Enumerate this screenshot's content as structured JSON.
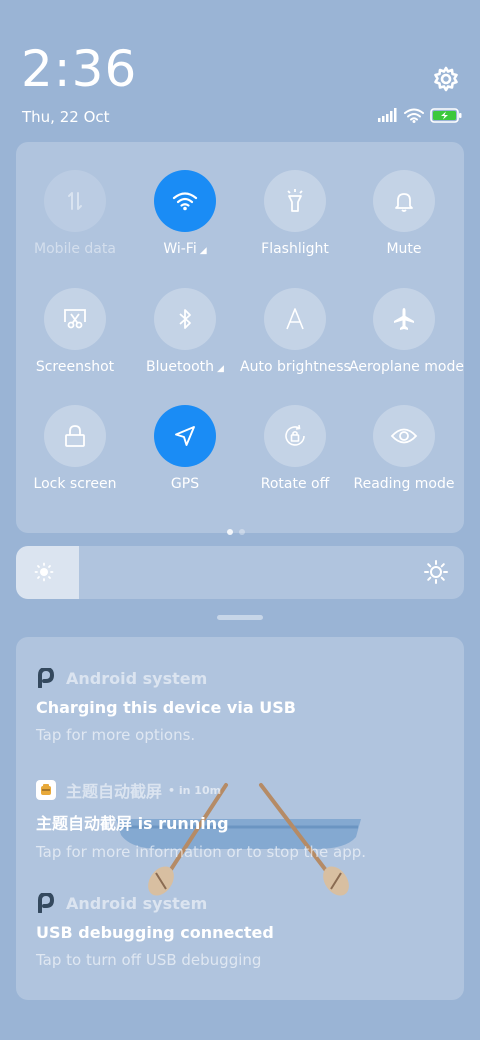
{
  "header": {
    "time": "2:36",
    "date": "Thu, 22 Oct",
    "settings_icon": "gear-icon",
    "status_icons": [
      "signal-icon",
      "wifi-icon",
      "battery-charging-icon"
    ],
    "battery_color": "#3cc83c"
  },
  "quick_settings": {
    "accent_color": "#1a8cf5",
    "tiles": [
      {
        "label": "Mobile data",
        "icon": "mobile-data-icon",
        "state": "disabled"
      },
      {
        "label": "Wi-Fi",
        "icon": "wifi-icon",
        "state": "on",
        "has_more": true
      },
      {
        "label": "Flashlight",
        "icon": "flashlight-icon",
        "state": "off"
      },
      {
        "label": "Mute",
        "icon": "bell-icon",
        "state": "off"
      },
      {
        "label": "Screenshot",
        "icon": "screenshot-icon",
        "state": "off"
      },
      {
        "label": "Bluetooth",
        "icon": "bluetooth-icon",
        "state": "off",
        "has_more": true
      },
      {
        "label": "Auto brightness",
        "icon": "auto-brightness-icon",
        "state": "off"
      },
      {
        "label": "Aeroplane mode",
        "icon": "airplane-icon",
        "state": "off"
      },
      {
        "label": "Lock screen",
        "icon": "lock-icon",
        "state": "off"
      },
      {
        "label": "GPS",
        "icon": "location-arrow-icon",
        "state": "on"
      },
      {
        "label": "Rotate off",
        "icon": "rotation-lock-icon",
        "state": "off"
      },
      {
        "label": "Reading mode",
        "icon": "eye-icon",
        "state": "off"
      }
    ],
    "page_count": 2,
    "current_page": 1
  },
  "brightness": {
    "level": 0.14
  },
  "notifications": [
    {
      "app_name": "Android system",
      "time": "",
      "title": "Charging this device via USB",
      "body": "Tap for more options.",
      "icon": "android-p-icon"
    },
    {
      "app_name": "主题自动截屏",
      "time": "• in 10m",
      "title": "主题自动截屏 is running",
      "body": "Tap for more information or to stop the app.",
      "icon": "app-theme-icon"
    },
    {
      "app_name": "Android system",
      "time": "",
      "title": "USB debugging connected",
      "body": "Tap to turn off USB debugging",
      "icon": "android-p-icon"
    }
  ]
}
